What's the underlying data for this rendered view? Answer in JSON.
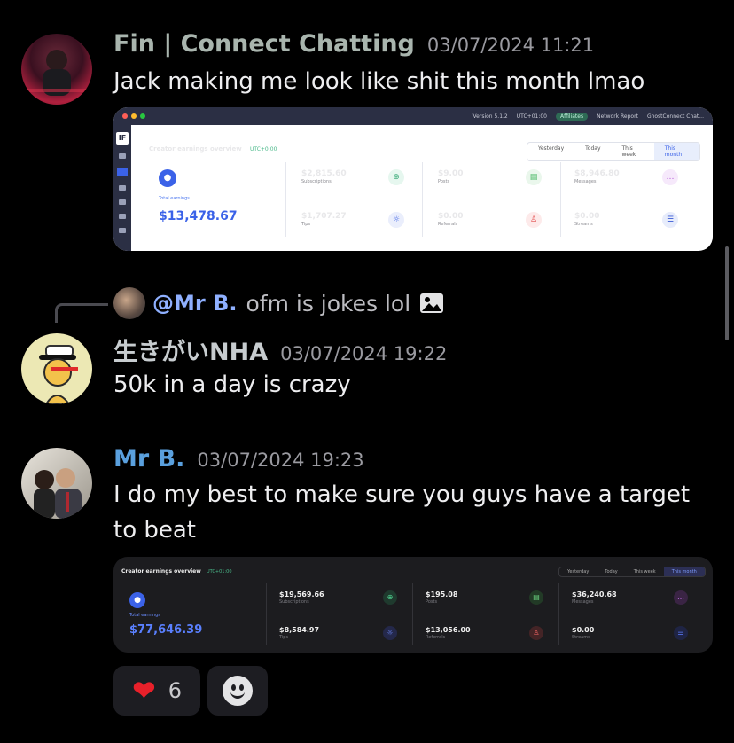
{
  "colors": {
    "fin_name": "#a9b5ae",
    "nha_name": "#c7cccf",
    "mrb_name": "#5aa0de",
    "mention": "#8fb0ff",
    "heart": "#e8202a"
  },
  "messages": [
    {
      "author": "Fin | Connect Chatting",
      "timestamp": "03/07/2024 11:21",
      "text": "Jack making me look like shit this month lmao",
      "avatar_icon": "fin-avatar"
    },
    {
      "author": "生きがいNHA",
      "timestamp": "03/07/2024 19:22",
      "text": "50k in a day is crazy",
      "avatar_icon": "nha-avatar",
      "reply": {
        "mention": "@Mr B.",
        "text": "ofm is jokes lol",
        "attachment_icon": "image-icon"
      }
    },
    {
      "author": "Mr B.",
      "timestamp": "03/07/2024 19:23",
      "text": "I do my best to make sure you guys have a target to beat",
      "avatar_icon": "mrb-avatar"
    }
  ],
  "embed1": {
    "topbar": {
      "version": "Version 5.1.2",
      "tz": "UTC+01:00",
      "affiliates": "Affiliates",
      "network": "Network Report",
      "account": "GhostConnect Chat..."
    },
    "title": "Creator earnings overview",
    "tz": "UTC+0:00",
    "tabs": [
      "Yesterday",
      "Today",
      "This week",
      "This month"
    ],
    "active_tab": "This month",
    "total_label": "Total earnings",
    "total_value": "$13,478.67",
    "stats": [
      {
        "value": "$2,815.60",
        "label": "Subscriptions",
        "icon": "subscriptions-icon"
      },
      {
        "value": "$9.00",
        "label": "Posts",
        "icon": "posts-icon"
      },
      {
        "value": "$8,946.80",
        "label": "Messages",
        "icon": "messages-icon"
      },
      {
        "value": "$1,707.27",
        "label": "Tips",
        "icon": "tips-icon"
      },
      {
        "value": "$0.00",
        "label": "Referrals",
        "icon": "referrals-icon"
      },
      {
        "value": "$0.00",
        "label": "Streams",
        "icon": "streams-icon"
      }
    ]
  },
  "embed2": {
    "title": "Creator earnings overview",
    "tz": "UTC+01:00",
    "tabs": [
      "Yesterday",
      "Today",
      "This week",
      "This month"
    ],
    "active_tab": "This month",
    "total_label": "Total earnings",
    "total_value": "$77,646.39",
    "stats": [
      {
        "value": "$19,569.66",
        "label": "Subscriptions"
      },
      {
        "value": "$195.08",
        "label": "Posts"
      },
      {
        "value": "$36,240.68",
        "label": "Messages"
      },
      {
        "value": "$8,584.97",
        "label": "Tips"
      },
      {
        "value": "$13,056.00",
        "label": "Referrals"
      },
      {
        "value": "$0.00",
        "label": "Streams"
      }
    ]
  },
  "reactions": [
    {
      "emoji": "❤️",
      "icon": "heart-icon",
      "count": "6"
    },
    {
      "icon": "add-reaction-icon"
    }
  ]
}
